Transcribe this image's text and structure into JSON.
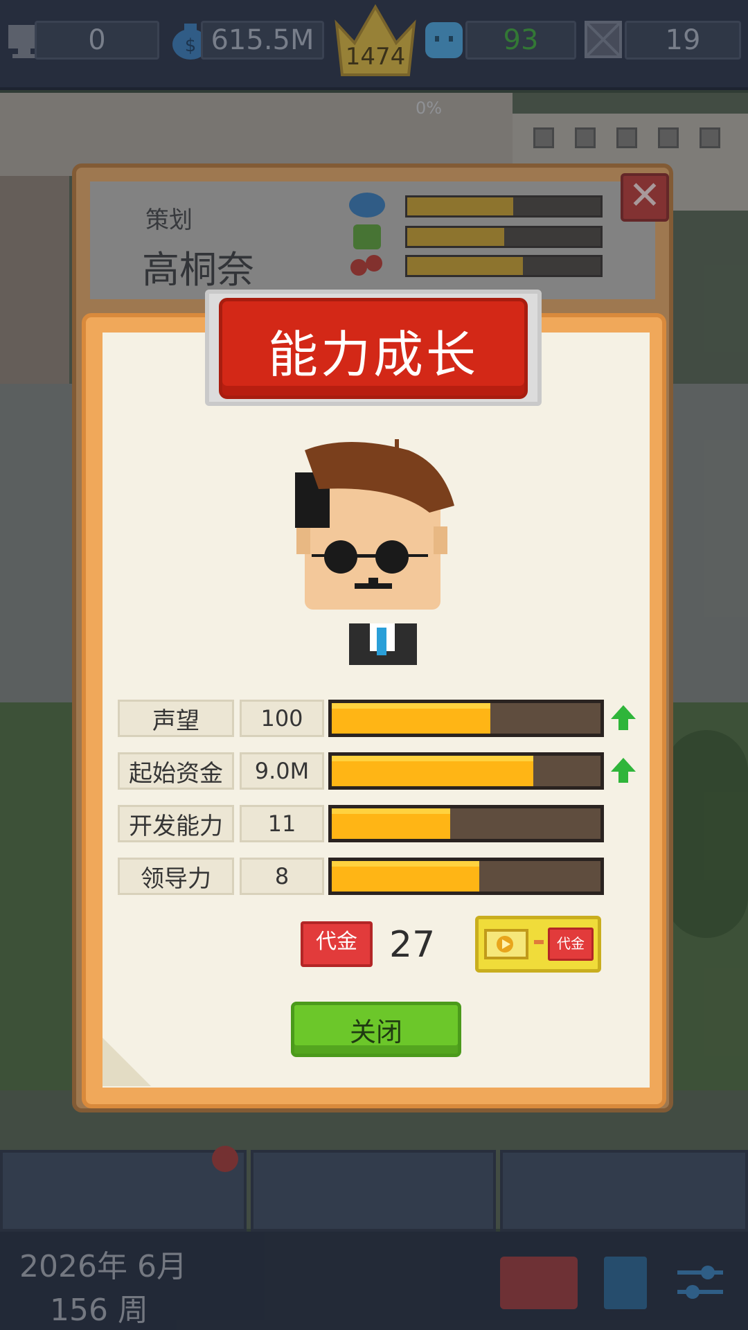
{
  "top_bar": {
    "research_points": "0",
    "money": "615.5M",
    "rank": "1474",
    "fans": "93",
    "other": "19",
    "progress": "0%"
  },
  "employee_card": {
    "role": "策划",
    "name": "高桐奈",
    "bars": [
      0.55,
      0.5,
      0.6
    ]
  },
  "dialog": {
    "title": "能力成长",
    "stats": [
      {
        "label": "声望",
        "value": "100",
        "fill": 0.59,
        "up": true
      },
      {
        "label": "起始资金",
        "value": "9.0M",
        "fill": 0.75,
        "up": true
      },
      {
        "label": "开发能力",
        "value": "11",
        "fill": 0.44,
        "up": false
      },
      {
        "label": "领导力",
        "value": "8",
        "fill": 0.55,
        "up": false
      }
    ],
    "coupon_icon_text": "代金",
    "coupon_count": "27",
    "close_label": "关闭"
  },
  "bottom": {
    "date_line1": "2026年 6月",
    "date_line2": "156 周"
  },
  "colors": {
    "dialog_orange": "#f0a85a",
    "banner_red": "#d32817",
    "bar_fill": "#ffb515",
    "close_green": "#6cc72a"
  }
}
